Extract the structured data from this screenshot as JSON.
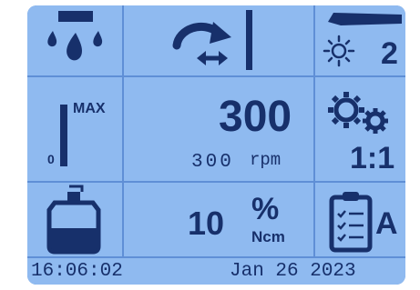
{
  "spray": {
    "icon": "water-drops-icon"
  },
  "direction": {
    "icon": "rotation-direction-icon"
  },
  "light": {
    "icon": "handpiece-light-icon",
    "level": "2"
  },
  "coolant": {
    "max_label": "MAX",
    "min_label": "0",
    "icon": "coolant-level-bar-icon"
  },
  "speed": {
    "value": "300",
    "subvalue": "300",
    "unit": "rpm"
  },
  "gear": {
    "icon": "gears-icon",
    "ratio": "1:1"
  },
  "bottle": {
    "icon": "irrigation-bottle-icon"
  },
  "torque": {
    "value": "10",
    "unit_top": "%",
    "unit_bottom": "Ncm"
  },
  "program": {
    "icon": "clipboard-checklist-icon",
    "letter": "A"
  },
  "status_bar": {
    "time": "16:06:02",
    "date": "Jan 26 2023"
  },
  "colors": {
    "lcd_background": "#8fbaf0",
    "grid_lines": "#5f8fd6",
    "ink": "#17306b"
  }
}
